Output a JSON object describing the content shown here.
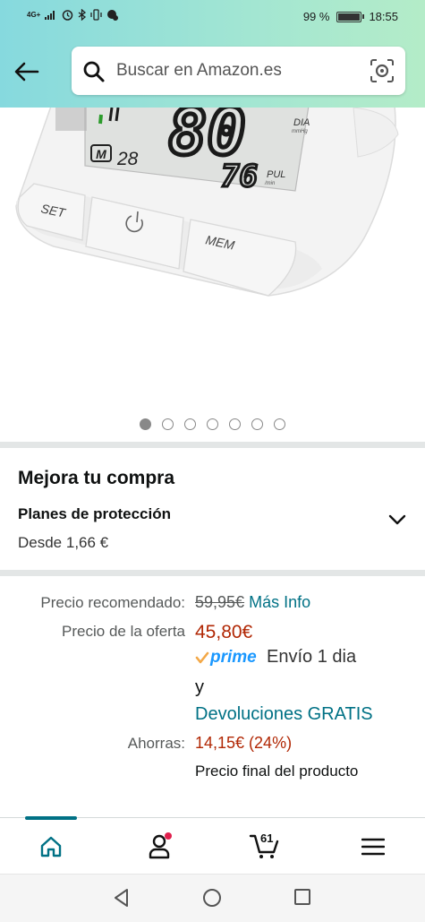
{
  "status_bar": {
    "network": "4G+",
    "battery_percent": "99 %",
    "battery_level": 0.99,
    "time": "18:55"
  },
  "header": {
    "back_icon": "arrow-left-icon",
    "search_placeholder": "Buscar en Amazon.es",
    "search_icon": "search-icon",
    "lens_icon": "camera-lens-icon",
    "gradient_colors": [
      "#86d9de",
      "#b4ecc8"
    ]
  },
  "product_image": {
    "buttons": [
      "SET",
      "MEM"
    ],
    "display": {
      "memory_label": "M",
      "memory_number": "28",
      "dia_value": "80",
      "dia_label": "DIA",
      "dia_unit": "mmHg",
      "pul_value": "76",
      "pul_label": "PUL",
      "pul_unit": "/min"
    },
    "carousel_total": 7,
    "carousel_active": 1
  },
  "upgrade": {
    "title": "Mejora tu compra",
    "plans_label": "Planes de protección",
    "plans_price": "Desde 1,66 €"
  },
  "pricing": {
    "recommended_label": "Precio recomendado:",
    "recommended_value": "59,95€",
    "more_info": "Más Info",
    "offer_label": "Precio de la oferta",
    "offer_value": "45,80€",
    "prime_label": "prime",
    "shipping": "Envío 1 dia",
    "and": "y",
    "returns": "Devoluciones GRATIS",
    "savings_label": "Ahorras:",
    "savings_value": "14,15€ (24%)",
    "final_note": "Precio final del producto"
  },
  "bottom_nav": {
    "items": [
      "home-icon",
      "account-icon",
      "cart-icon",
      "menu-icon"
    ],
    "cart_count": "61",
    "accent": "#007185"
  },
  "colors": {
    "price": "#b12704",
    "link": "#007185",
    "prime": "#1a98ff"
  }
}
